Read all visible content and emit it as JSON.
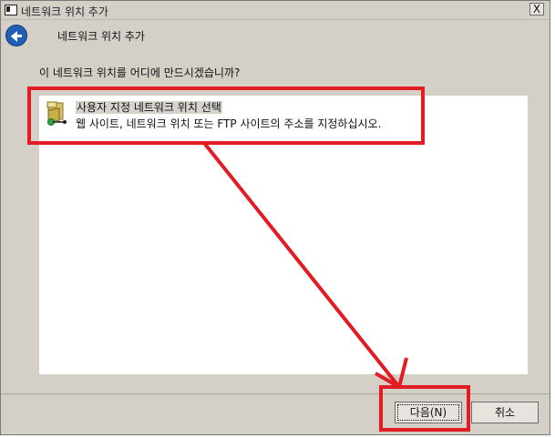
{
  "window": {
    "title": "네트워크 위치 추가",
    "close_label": "X"
  },
  "header": {
    "title": "네트워크 위치 추가"
  },
  "main": {
    "question": "이 네트워크 위치를 어디에 만드시겠습니까?",
    "options": [
      {
        "title": "사용자 지정 네트워크 위치 선택",
        "description": "웹 사이트, 네트워크 위치 또는 FTP 사이트의 주소를 지정하십시오.",
        "icon": "folder-network-icon"
      }
    ]
  },
  "buttons": {
    "next": "다음(N)",
    "cancel": "취소"
  },
  "annotations": {
    "highlight_color": "#e31b23",
    "icons": [
      "back-arrow-icon",
      "window-icon",
      "close-icon"
    ]
  }
}
